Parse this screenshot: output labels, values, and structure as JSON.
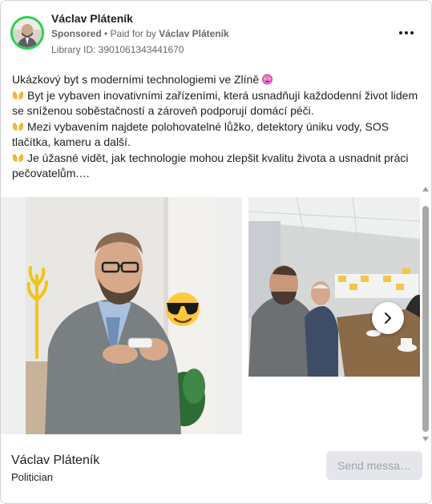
{
  "post": {
    "page_name": "Václav Pláteník",
    "sponsored_label": "Sponsored",
    "separator": " • ",
    "paid_for_prefix": "Paid for by ",
    "paid_for_name": "Václav Pláteník",
    "library_id": "Library ID: 3901061343441670",
    "text_lines": [
      "Ukázkový byt s moderními technologiemi ve Zlíně",
      "Byt je vybaven inovativními zařízeními, která usnadňují každodenní život lidem se sníženou soběstačností a zároveň podporují domácí péči.",
      "Mezi vybavením najdete polohovatelné lůžko, detektory úniku vody, SOS tlačítka, kameru a další.",
      "Je úžasné vidět, jak technologie mohou zlepšit kvalitu života a usnadnit práci pečovatelům.…"
    ],
    "emojis": [
      "star-struck-emoji",
      "open-hands-emoji",
      "open-hands-emoji",
      "open-hands-emoji"
    ]
  },
  "footer": {
    "name": "Václav Pláteník",
    "category": "Politician",
    "send_label": "Send messa…"
  },
  "icons": {
    "more": "more-options-icon",
    "next": "chevron-right-icon",
    "sunglasses": "sunglasses-emoji"
  },
  "colors": {
    "avatar_ring": "#2ad14a",
    "secondary_text": "#65676b",
    "send_button_bg": "#e4e6eb"
  }
}
